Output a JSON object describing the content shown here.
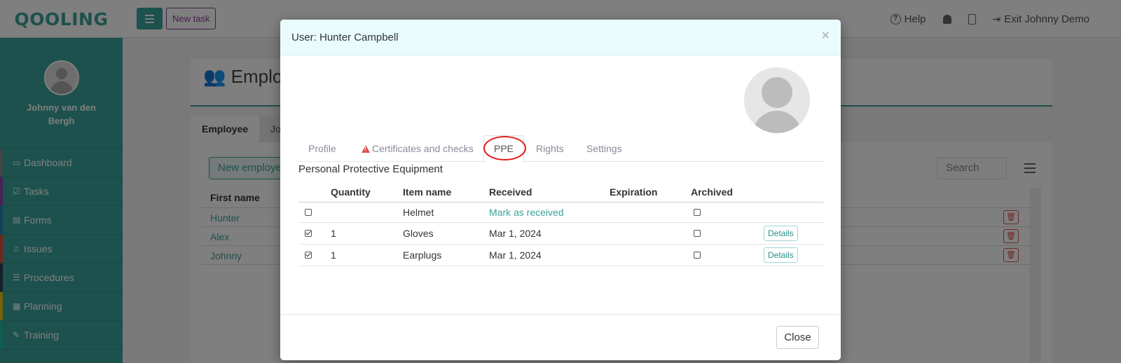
{
  "app": {
    "logo": "QOOLING",
    "new_task": "New task",
    "help": "Help",
    "exit": "Exit Johnny Demo"
  },
  "sidebar": {
    "user_name": "Johnny van den Bergh",
    "items": [
      {
        "label": "Dashboard",
        "icon": "monitor-icon",
        "color": "#7f8c8d"
      },
      {
        "label": "Tasks",
        "icon": "check-square-icon",
        "color": "#8e44ad"
      },
      {
        "label": "Forms",
        "icon": "file-icon",
        "color": "#2980b9"
      },
      {
        "label": "Issues",
        "icon": "bell-icon",
        "color": "#e74c3c"
      },
      {
        "label": "Procedures",
        "icon": "list-icon",
        "color": "#2c3e50"
      },
      {
        "label": "Planning",
        "icon": "calendar-icon",
        "color": "#f1c40f"
      },
      {
        "label": "Training",
        "icon": "graduation-cap-icon",
        "color": "#1abc9c"
      }
    ]
  },
  "page": {
    "title": "Employ",
    "tabs": [
      "Employee",
      "Job"
    ],
    "new_employee": "New employe",
    "search_placeholder": "Search",
    "first_name_header": "First name",
    "employees": [
      "Hunter",
      "Alex",
      "Johnny"
    ]
  },
  "modal": {
    "title": "User: Hunter Campbell",
    "close_x": "×",
    "tabs": [
      {
        "label": "Profile",
        "active": false
      },
      {
        "label": "Certificates and checks",
        "active": false,
        "warning": true
      },
      {
        "label": "PPE",
        "active": true
      },
      {
        "label": "Rights",
        "active": false
      },
      {
        "label": "Settings",
        "active": false
      }
    ],
    "section_title": "Personal Protective Equipment",
    "table": {
      "headers": [
        "Quantity",
        "Item name",
        "Received",
        "Expiration",
        "Archived"
      ],
      "rows": [
        {
          "checked": false,
          "quantity": "",
          "item": "Helmet",
          "received": "Mark as received",
          "received_is_link": true,
          "expiration": "",
          "archived": false,
          "details": ""
        },
        {
          "checked": true,
          "quantity": "1",
          "item": "Gloves",
          "received": "Mar 1, 2024",
          "received_is_link": false,
          "expiration": "",
          "archived": false,
          "details": "Details"
        },
        {
          "checked": true,
          "quantity": "1",
          "item": "Earplugs",
          "received": "Mar 1, 2024",
          "received_is_link": false,
          "expiration": "",
          "archived": false,
          "details": "Details"
        }
      ]
    },
    "close_button": "Close"
  },
  "colors": {
    "accent": "#3aa39a",
    "highlight": "#e21b1b",
    "warning": "#d9534f",
    "header_bg": "#e9fbfd"
  }
}
